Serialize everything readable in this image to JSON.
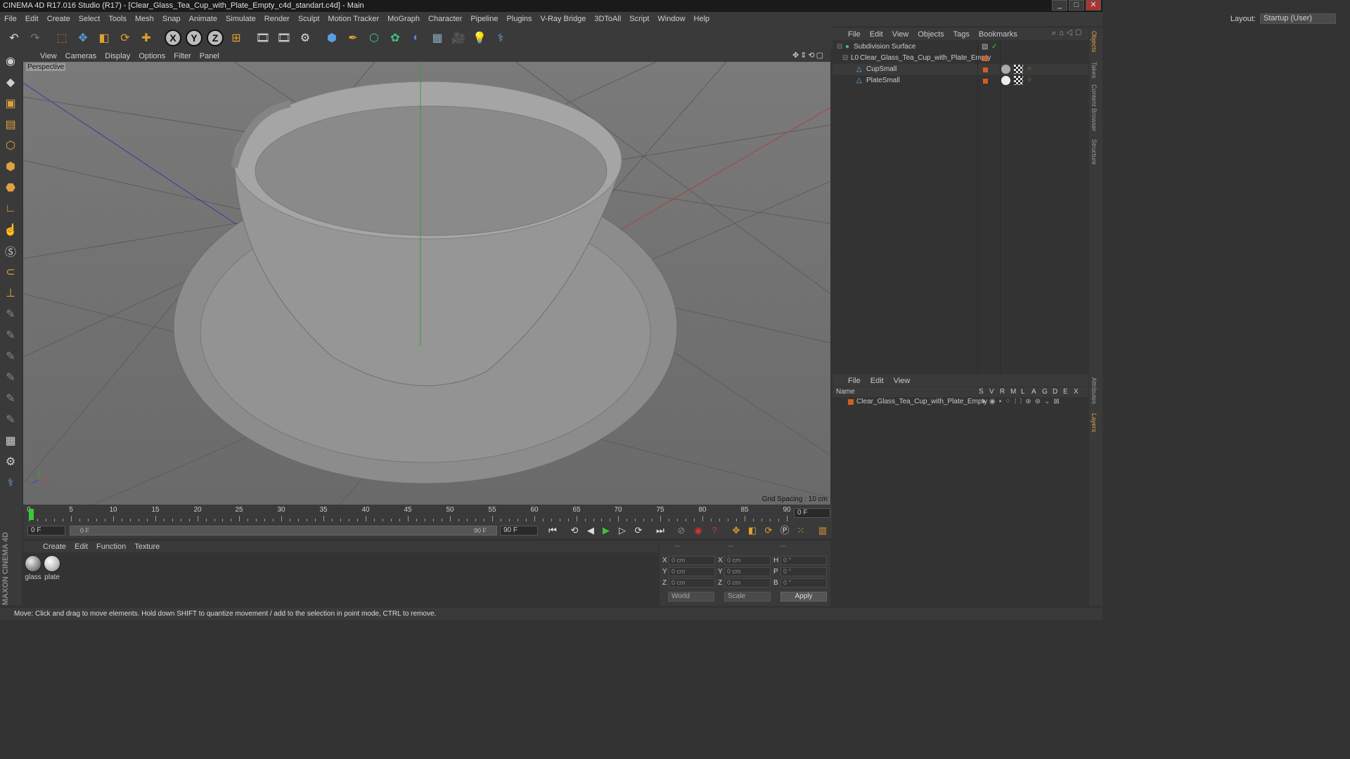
{
  "window": {
    "title": "CINEMA 4D R17.016 Studio (R17) - [Clear_Glass_Tea_Cup_with_Plate_Empty_c4d_standart.c4d] - Main",
    "buttons": [
      "_",
      "□",
      "✕"
    ]
  },
  "menubar": {
    "items": [
      "File",
      "Edit",
      "Create",
      "Select",
      "Tools",
      "Mesh",
      "Snap",
      "Animate",
      "Simulate",
      "Render",
      "Sculpt",
      "Motion Tracker",
      "MoGraph",
      "Character",
      "Pipeline",
      "Plugins",
      "V-Ray Bridge",
      "3DToAll",
      "Script",
      "Window",
      "Help"
    ],
    "layout_label": "Layout:",
    "layout_value": "Startup (User)"
  },
  "toolbar": {
    "axis_x": "X",
    "axis_y": "Y",
    "axis_z": "Z"
  },
  "viewport": {
    "menu": [
      "View",
      "Cameras",
      "Display",
      "Options",
      "Filter",
      "Panel"
    ],
    "camera_label": "Perspective",
    "grid_spacing": "Grid Spacing : 10 cm"
  },
  "timeline": {
    "ticks": [
      "0",
      "5",
      "10",
      "15",
      "20",
      "25",
      "30",
      "35",
      "40",
      "45",
      "50",
      "55",
      "60",
      "65",
      "70",
      "75",
      "80",
      "85",
      "90"
    ],
    "current_frame": "0 F",
    "start_field": "0 F",
    "range_start": "0 F",
    "range_end": "90 F",
    "end_field": "90 F"
  },
  "materials": {
    "menu": [
      "Create",
      "Edit",
      "Function",
      "Texture"
    ],
    "items": [
      {
        "name": "glass"
      },
      {
        "name": "plate"
      }
    ]
  },
  "coordinates": {
    "headers": [
      "--",
      "--",
      "--"
    ],
    "rows": [
      {
        "a": "X",
        "av": "0 cm",
        "b": "X",
        "bv": "0 cm",
        "c": "H",
        "cv": "0 °"
      },
      {
        "a": "Y",
        "av": "0 cm",
        "b": "Y",
        "bv": "0 cm",
        "c": "P",
        "cv": "0 °"
      },
      {
        "a": "Z",
        "av": "0 cm",
        "b": "Z",
        "bv": "0 cm",
        "c": "B",
        "cv": "0 °"
      }
    ],
    "space": "World",
    "mode": "Scale",
    "apply": "Apply"
  },
  "status": "Move: Click and drag to move elements. Hold down SHIFT to quantize movement / add to the selection in point mode, CTRL to remove.",
  "objects": {
    "menu": [
      "File",
      "Edit",
      "View",
      "Objects",
      "Tags",
      "Bookmarks"
    ],
    "items": [
      {
        "name": "Subdivision Surface"
      },
      {
        "name": "Clear_Glass_Tea_Cup_with_Plate_Empty"
      },
      {
        "name": "CupSmall"
      },
      {
        "name": "PlateSmall"
      }
    ]
  },
  "layers": {
    "menu": [
      "File",
      "Edit",
      "View"
    ],
    "name_header": "Name",
    "col_headers": [
      "S",
      "V",
      "R",
      "M",
      "L",
      "A",
      "G",
      "D",
      "E",
      "X"
    ],
    "rows": [
      {
        "name": "Clear_Glass_Tea_Cup_with_Plate_Empty"
      }
    ]
  },
  "right_tabs": [
    "Objects",
    "Takes",
    "Content Browser",
    "Structure",
    "Attributes",
    "Layers"
  ],
  "branding": "MAXON CINEMA 4D"
}
